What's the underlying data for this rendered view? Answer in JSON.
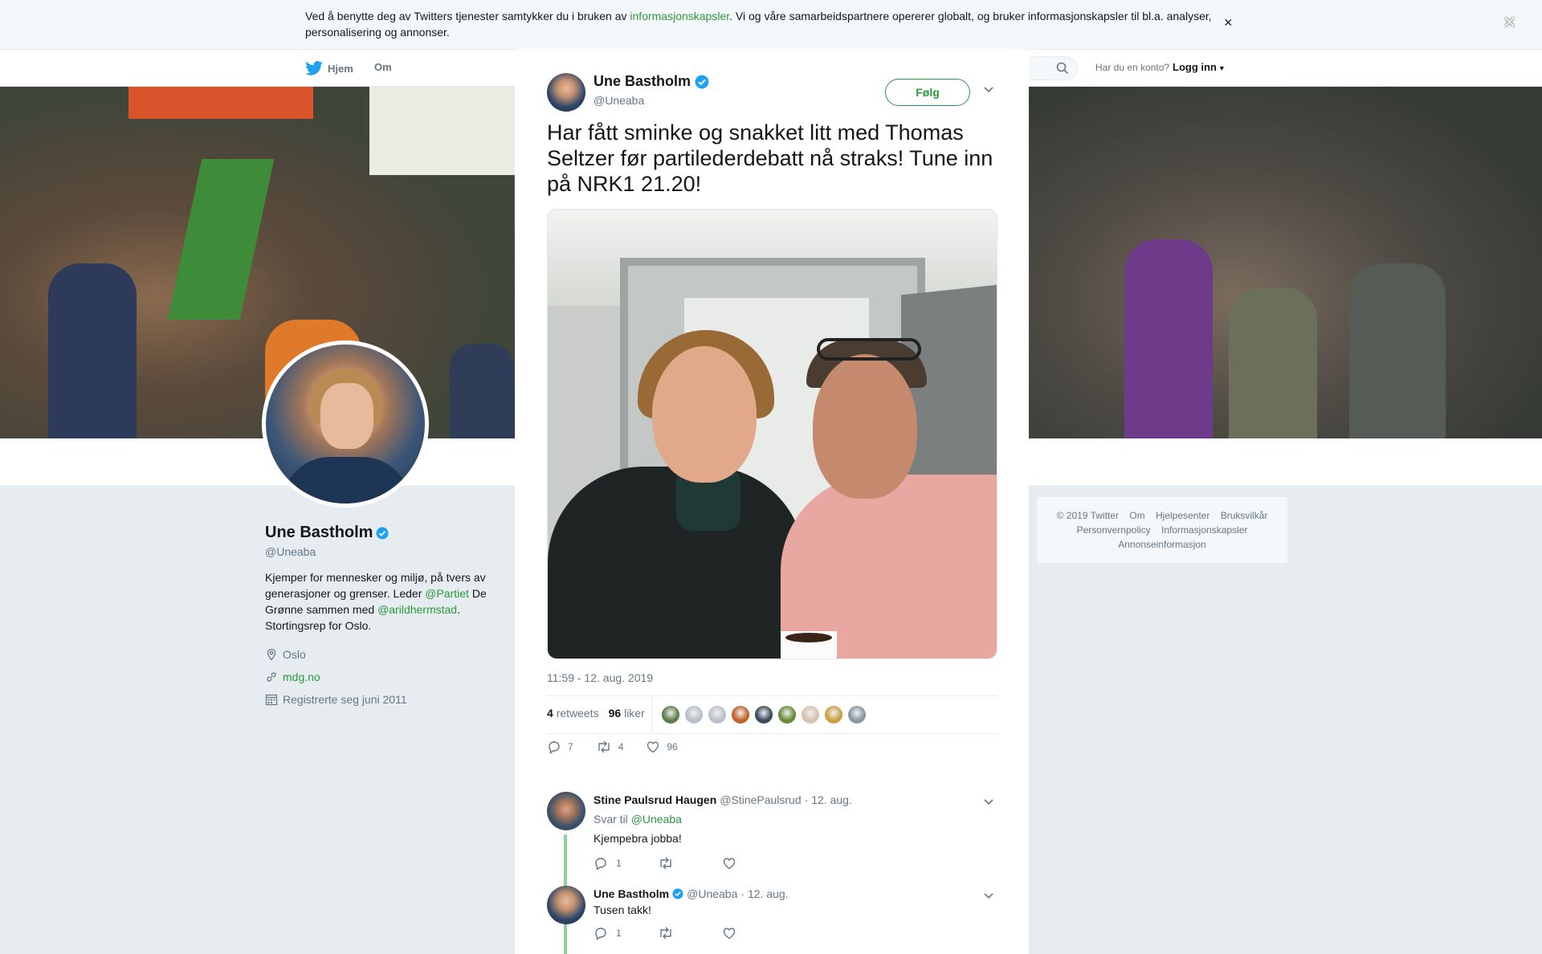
{
  "cookie_bar": {
    "text_before": "Ved å benytte deg av Twitters tjenester samtykker du i bruken av ",
    "link": "informasjonskapsler",
    "text_after": ". Vi og våre samarbeidspartnere opererer globalt, og bruker informasjonskapsler til bl.a. analyser, personalisering og annonser.",
    "close": "×"
  },
  "nav": {
    "home": "Hjem",
    "about": "Om",
    "login_question": "Har du en konto?",
    "login": "Logg inn"
  },
  "profile": {
    "name": "Une Bastholm",
    "handle": "@Uneaba",
    "bio_1": "Kjemper for mennesker og miljø, på tvers av generasjoner og grenser. Leder ",
    "bio_link_1": "@Partiet",
    "bio_2": " De Grønne sammen med ",
    "bio_link_2": "@arildhermstad",
    "bio_3": ". Stortingsrep for Oslo.",
    "location": "Oslo",
    "website": "mdg.no",
    "joined": "Registrerte seg juni 2011"
  },
  "footer": {
    "copyright": "© 2019 Twitter",
    "about": "Om",
    "help": "Hjelpesenter",
    "terms": "Bruksvilkår",
    "privacy": "Personvernpolicy",
    "cookies": "Informasjonskapsler",
    "ads": "Annonseinformasjon"
  },
  "overlay_close": "×",
  "tweet": {
    "name": "Une Bastholm",
    "handle": "@Uneaba",
    "follow": "Følg",
    "text": "Har fått sminke og snakket litt med Thomas Seltzer før partilederdebatt nå straks! Tune inn på NRK1 21.20!",
    "time": "11:59 - 12. aug. 2019",
    "retweets_count": "4",
    "retweets_label": "retweets",
    "likes_count": "96",
    "likes_label": "liker",
    "replies": "7",
    "retweets": "4",
    "likes": "96"
  },
  "liker_faces": [
    "#5e7d4a",
    "#b8c0c8",
    "#b8c0c8",
    "#c0622a",
    "#3a4a5a",
    "#6a8a3a",
    "#d8c0b0",
    "#c8a040",
    "#8a96a0"
  ],
  "replies": [
    {
      "name": "Stine Paulsrud Haugen",
      "handle": "@StinePaulsrud",
      "date": "· 12. aug.",
      "reply_to_label": "Svar til",
      "reply_to": "@Uneaba",
      "text": "Kjempebra jobba!",
      "replies": "1",
      "retweets": "",
      "likes": ""
    },
    {
      "name": "Une Bastholm",
      "handle": "@Uneaba",
      "date": "· 12. aug.",
      "text": "Tusen takk!",
      "replies": "1",
      "retweets": "",
      "likes": ""
    }
  ],
  "colors": {
    "accent": "#2b9a3c",
    "verified": "#1da1f2",
    "thread_line": "#8fd09a"
  }
}
